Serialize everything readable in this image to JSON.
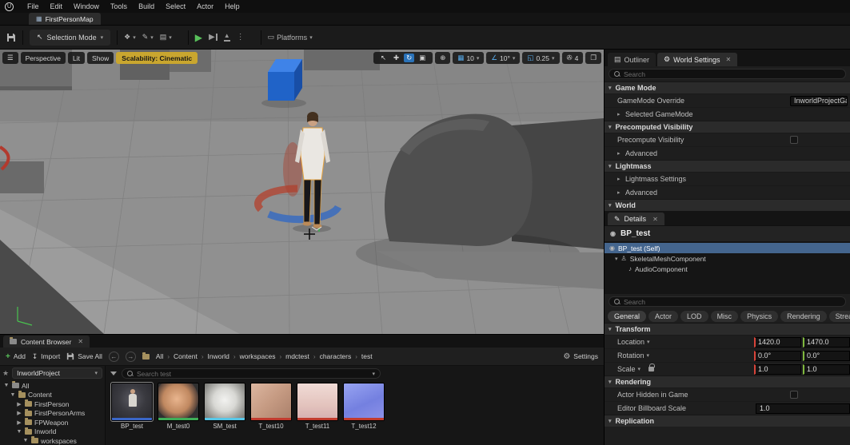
{
  "colors": {
    "accent_blue": "#2a72b8",
    "selection_orange": "#e8a33d",
    "play_green": "#58c05a",
    "scalability_badge": "#c9a62f",
    "axis_x_red": "#d9443a",
    "axis_y_green": "#7fb83e",
    "selected_row_blue": "#44658e"
  },
  "menubar": {
    "logo": "U",
    "items": [
      "File",
      "Edit",
      "Window",
      "Tools",
      "Build",
      "Select",
      "Actor",
      "Help"
    ]
  },
  "level_tab": {
    "label": "FirstPersonMap"
  },
  "toolbar": {
    "selection_mode_label": "Selection Mode",
    "platforms_label": "Platforms"
  },
  "viewport": {
    "perspective_label": "Perspective",
    "lit_label": "Lit",
    "show_label": "Show",
    "scalability_label": "Scalability: Cinematic",
    "grid_snap_value": "10",
    "rotation_snap_value": "10°",
    "scale_snap_value": "0.25",
    "camera_speed_value": "4"
  },
  "world_settings": {
    "tab_outliner": "Outliner",
    "tab_world_settings": "World Settings",
    "search_placeholder": "Search",
    "game_mode_header": "Game Mode",
    "gamemode_override_label": "GameMode Override",
    "gamemode_override_value": "InworldProjectGa",
    "selected_gamemode_label": "Selected GameMode",
    "precomputed_visibility_header": "Precomputed Visibility",
    "precompute_visibility_label": "Precompute Visibility",
    "advanced_label": "Advanced",
    "lightmass_header": "Lightmass",
    "lightmass_settings_label": "Lightmass Settings",
    "world_header": "World"
  },
  "details": {
    "tab_label": "Details",
    "actor_name": "BP_test",
    "components": [
      {
        "label": "BP_test (Self)"
      },
      {
        "label": "SkeletalMeshComponent"
      },
      {
        "label": "AudioComponent"
      }
    ],
    "search_placeholder": "Search",
    "categories": [
      "General",
      "Actor",
      "LOD",
      "Misc",
      "Physics",
      "Rendering",
      "Streaming"
    ],
    "transform_header": "Transform",
    "location_label": "Location",
    "location_x": "1420.0",
    "location_y": "1470.0",
    "rotation_label": "Rotation",
    "rotation_x": "0.0°",
    "rotation_y": "0.0°",
    "scale_label": "Scale",
    "scale_x": "1.0",
    "scale_y": "1.0",
    "rendering_header": "Rendering",
    "actor_hidden_label": "Actor Hidden in Game",
    "billboard_scale_label": "Editor Billboard Scale",
    "billboard_scale_value": "1.0",
    "replication_header": "Replication"
  },
  "content_browser": {
    "tab_label": "Content Browser",
    "add_label": "Add",
    "import_label": "Import",
    "save_all_label": "Save All",
    "breadcrumb": [
      "All",
      "Content",
      "Inworld",
      "workspaces",
      "mdctest",
      "characters",
      "test"
    ],
    "settings_label": "Settings",
    "source_selector": "InworldProject",
    "tree": [
      {
        "label": "All"
      },
      {
        "label": "Content"
      },
      {
        "label": "FirstPerson"
      },
      {
        "label": "FirstPersonArms"
      },
      {
        "label": "FPWeapon"
      },
      {
        "label": "Inworld"
      },
      {
        "label": "workspaces"
      }
    ],
    "search_placeholder": "Search test",
    "assets": [
      {
        "name": "BP_test",
        "type_color": "#3a66c8"
      },
      {
        "name": "M_test0",
        "type_color": "#3fae58"
      },
      {
        "name": "SM_test",
        "type_color": "#58c8e8"
      },
      {
        "name": "T_test10",
        "type_color": "#c23b2e"
      },
      {
        "name": "T_test11",
        "type_color": "#c23b2e"
      },
      {
        "name": "T_test12",
        "type_color": "#c23b2e"
      }
    ]
  }
}
